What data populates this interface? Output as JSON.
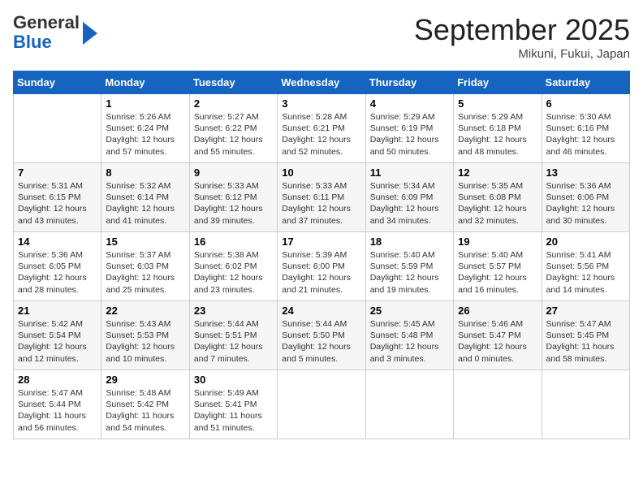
{
  "logo": {
    "general": "General",
    "blue": "Blue"
  },
  "title": "September 2025",
  "location": "Mikuni, Fukui, Japan",
  "days_of_week": [
    "Sunday",
    "Monday",
    "Tuesday",
    "Wednesday",
    "Thursday",
    "Friday",
    "Saturday"
  ],
  "weeks": [
    [
      {
        "day": "",
        "info": ""
      },
      {
        "day": "1",
        "info": "Sunrise: 5:26 AM\nSunset: 6:24 PM\nDaylight: 12 hours\nand 57 minutes."
      },
      {
        "day": "2",
        "info": "Sunrise: 5:27 AM\nSunset: 6:22 PM\nDaylight: 12 hours\nand 55 minutes."
      },
      {
        "day": "3",
        "info": "Sunrise: 5:28 AM\nSunset: 6:21 PM\nDaylight: 12 hours\nand 52 minutes."
      },
      {
        "day": "4",
        "info": "Sunrise: 5:29 AM\nSunset: 6:19 PM\nDaylight: 12 hours\nand 50 minutes."
      },
      {
        "day": "5",
        "info": "Sunrise: 5:29 AM\nSunset: 6:18 PM\nDaylight: 12 hours\nand 48 minutes."
      },
      {
        "day": "6",
        "info": "Sunrise: 5:30 AM\nSunset: 6:16 PM\nDaylight: 12 hours\nand 46 minutes."
      }
    ],
    [
      {
        "day": "7",
        "info": "Sunrise: 5:31 AM\nSunset: 6:15 PM\nDaylight: 12 hours\nand 43 minutes."
      },
      {
        "day": "8",
        "info": "Sunrise: 5:32 AM\nSunset: 6:14 PM\nDaylight: 12 hours\nand 41 minutes."
      },
      {
        "day": "9",
        "info": "Sunrise: 5:33 AM\nSunset: 6:12 PM\nDaylight: 12 hours\nand 39 minutes."
      },
      {
        "day": "10",
        "info": "Sunrise: 5:33 AM\nSunset: 6:11 PM\nDaylight: 12 hours\nand 37 minutes."
      },
      {
        "day": "11",
        "info": "Sunrise: 5:34 AM\nSunset: 6:09 PM\nDaylight: 12 hours\nand 34 minutes."
      },
      {
        "day": "12",
        "info": "Sunrise: 5:35 AM\nSunset: 6:08 PM\nDaylight: 12 hours\nand 32 minutes."
      },
      {
        "day": "13",
        "info": "Sunrise: 5:36 AM\nSunset: 6:06 PM\nDaylight: 12 hours\nand 30 minutes."
      }
    ],
    [
      {
        "day": "14",
        "info": "Sunrise: 5:36 AM\nSunset: 6:05 PM\nDaylight: 12 hours\nand 28 minutes."
      },
      {
        "day": "15",
        "info": "Sunrise: 5:37 AM\nSunset: 6:03 PM\nDaylight: 12 hours\nand 25 minutes."
      },
      {
        "day": "16",
        "info": "Sunrise: 5:38 AM\nSunset: 6:02 PM\nDaylight: 12 hours\nand 23 minutes."
      },
      {
        "day": "17",
        "info": "Sunrise: 5:39 AM\nSunset: 6:00 PM\nDaylight: 12 hours\nand 21 minutes."
      },
      {
        "day": "18",
        "info": "Sunrise: 5:40 AM\nSunset: 5:59 PM\nDaylight: 12 hours\nand 19 minutes."
      },
      {
        "day": "19",
        "info": "Sunrise: 5:40 AM\nSunset: 5:57 PM\nDaylight: 12 hours\nand 16 minutes."
      },
      {
        "day": "20",
        "info": "Sunrise: 5:41 AM\nSunset: 5:56 PM\nDaylight: 12 hours\nand 14 minutes."
      }
    ],
    [
      {
        "day": "21",
        "info": "Sunrise: 5:42 AM\nSunset: 5:54 PM\nDaylight: 12 hours\nand 12 minutes."
      },
      {
        "day": "22",
        "info": "Sunrise: 5:43 AM\nSunset: 5:53 PM\nDaylight: 12 hours\nand 10 minutes."
      },
      {
        "day": "23",
        "info": "Sunrise: 5:44 AM\nSunset: 5:51 PM\nDaylight: 12 hours\nand 7 minutes."
      },
      {
        "day": "24",
        "info": "Sunrise: 5:44 AM\nSunset: 5:50 PM\nDaylight: 12 hours\nand 5 minutes."
      },
      {
        "day": "25",
        "info": "Sunrise: 5:45 AM\nSunset: 5:48 PM\nDaylight: 12 hours\nand 3 minutes."
      },
      {
        "day": "26",
        "info": "Sunrise: 5:46 AM\nSunset: 5:47 PM\nDaylight: 12 hours\nand 0 minutes."
      },
      {
        "day": "27",
        "info": "Sunrise: 5:47 AM\nSunset: 5:45 PM\nDaylight: 11 hours\nand 58 minutes."
      }
    ],
    [
      {
        "day": "28",
        "info": "Sunrise: 5:47 AM\nSunset: 5:44 PM\nDaylight: 11 hours\nand 56 minutes."
      },
      {
        "day": "29",
        "info": "Sunrise: 5:48 AM\nSunset: 5:42 PM\nDaylight: 11 hours\nand 54 minutes."
      },
      {
        "day": "30",
        "info": "Sunrise: 5:49 AM\nSunset: 5:41 PM\nDaylight: 11 hours\nand 51 minutes."
      },
      {
        "day": "",
        "info": ""
      },
      {
        "day": "",
        "info": ""
      },
      {
        "day": "",
        "info": ""
      },
      {
        "day": "",
        "info": ""
      }
    ]
  ]
}
